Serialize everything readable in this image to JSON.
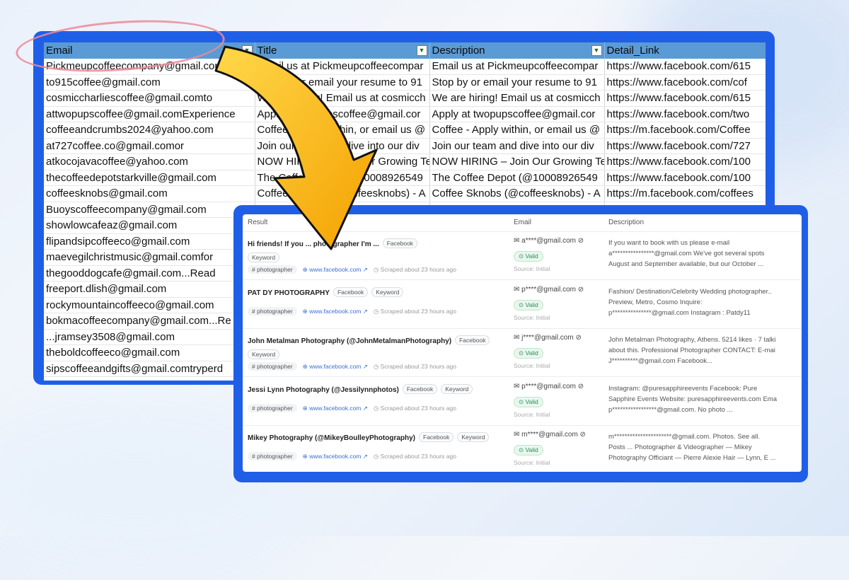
{
  "sheet": {
    "headers": [
      "Email",
      "Title",
      "Description",
      "Detail_Link"
    ],
    "rows": [
      [
        "Pickmeupcoffeecompany@gmail.comfor",
        "Email us at Pickmeupcoffeecompar",
        "Email us at Pickmeupcoffeecompar",
        "https://www.facebook.com/615"
      ],
      [
        "to915coffee@gmail.com",
        "Stop by or email your resume to 91",
        "Stop by or email your resume to 91",
        "https://www.facebook.com/cof"
      ],
      [
        "cosmiccharliescoffee@gmail.comto",
        "We are hiring! Email us at cosmicch",
        "We are hiring! Email us at cosmicch",
        "https://www.facebook.com/615"
      ],
      [
        "attwopupscoffee@gmail.comExperience",
        "Apply at twopupscoffee@gmail.cor",
        "Apply at twopupscoffee@gmail.cor",
        "https://www.facebook.com/two"
      ],
      [
        "coffeeandcrumbs2024@yahoo.com",
        "Coffee - Apply within, or email us @",
        "Coffee - Apply within, or email us @",
        "https://m.facebook.com/Coffee"
      ],
      [
        "at727coffee.co@gmail.comor",
        "Join our team and dive into our div",
        "Join our team and dive into our div",
        "https://www.facebook.com/727"
      ],
      [
        "atkocojavacoffee@yahoo.com",
        "NOW HIRING – Join Our Growing Te",
        "NOW HIRING – Join Our Growing Te",
        "https://www.facebook.com/100"
      ],
      [
        "thecoffeedepotstarkville@gmail.com",
        "The Coffee Depot (@10008926549",
        "The Coffee Depot (@10008926549",
        "https://www.facebook.com/100"
      ],
      [
        "coffeesknobs@gmail.com",
        "Coffee Sknobs (@coffeesknobs) - A",
        "Coffee Sknobs (@coffeesknobs) - A",
        "https://m.facebook.com/coffees"
      ],
      [
        "Buoyscoffeecompany@gmail.com",
        "",
        "",
        ""
      ],
      [
        "showlowcafeaz@gmail.com",
        "",
        "",
        ""
      ],
      [
        "flipandsipcoffeeco@gmail.com",
        "",
        "",
        ""
      ],
      [
        "maevegilchristmusic@gmail.comfor",
        "",
        "",
        ""
      ],
      [
        "thegooddogcafe@gmail.com...Read",
        "",
        "",
        ""
      ],
      [
        "freeport.dlish@gmail.com",
        "",
        "",
        ""
      ],
      [
        "rockymountaincoffeeco@gmail.com",
        "",
        "",
        ""
      ],
      [
        "bokmacoffeecompany@gmail.com...Re",
        "",
        "",
        ""
      ],
      [
        "...jramsey3508@gmail.com",
        "",
        "",
        ""
      ],
      [
        "theboldcoffeeco@gmail.com",
        "",
        "",
        ""
      ],
      [
        "sipscoffeeandgifts@gmail.comtryperd",
        "",
        "",
        ""
      ]
    ]
  },
  "panel": {
    "col_result": "Result",
    "col_email": "Email",
    "col_description": "Description",
    "rows": [
      {
        "title": "Hi friends! If you ... photographer I'm ...",
        "tags": [
          "Facebook",
          "Keyword"
        ],
        "keyword": "# photographer",
        "link": "www.facebook.com",
        "scraped": "Scraped about 23 hours ago",
        "email": "a****@gmail.com",
        "valid": "Valid",
        "source": "Source: Initial",
        "desc": [
          "If you want to book with us please e-mail",
          "a****************@gmail.com We've got several spots",
          "August and September available, but our October ..."
        ]
      },
      {
        "title": "PAT DY PHOTOGRAPHY",
        "tags": [
          "Facebook",
          "Keyword"
        ],
        "keyword": "# photographer",
        "link": "www.facebook.com",
        "scraped": "Scraped about 23 hours ago",
        "email": "p****@gmail.com",
        "valid": "Valid",
        "source": "Source: Initial",
        "desc": [
          "Fashion/ Destination/Celebrity Wedding photographer..",
          "Preview, Metro, Cosmo Inquire:",
          "p***************@gmail.com Instagram : Patdy11"
        ]
      },
      {
        "title": "John Metalman Photography (@JohnMetalmanPhotography)",
        "tags": [
          "Facebook",
          "Keyword"
        ],
        "keyword": "# photographer",
        "link": "www.facebook.com",
        "scraped": "Scraped about 23 hours ago",
        "email": "j****@gmail.com",
        "valid": "Valid",
        "source": "Source: Initial",
        "desc": [
          "John Metalman Photography, Athens. 5214 likes · 7 talki",
          "about this. Professional Photographer CONTACT: E-mai",
          "J**********@gmail.com Facebook..."
        ]
      },
      {
        "title": "Jessi Lynn Photography (@Jessilynnphotos)",
        "tags": [
          "Facebook",
          "Keyword"
        ],
        "keyword": "# photographer",
        "link": "www.facebook.com",
        "scraped": "Scraped about 23 hours ago",
        "email": "p****@gmail.com",
        "valid": "Valid",
        "source": "Source: Initial",
        "desc": [
          "Instagram: @puresapphireevents Facebook: Pure",
          "Sapphire Events Website: puresapphireevents.com Ema",
          "p*****************@gmail.com. No photo ..."
        ]
      },
      {
        "title": "Mikey Photography (@MikeyBoulleyPhotography)",
        "tags": [
          "Facebook",
          "Keyword"
        ],
        "keyword": "# photographer",
        "link": "www.facebook.com",
        "scraped": "Scraped about 23 hours ago",
        "email": "m****@gmail.com",
        "valid": "Valid",
        "source": "Source: Initial",
        "desc": [
          "m**********************@gmail.com. Photos. See all.",
          "Posts ... Photographer & Videographer — Mikey",
          "Photography Officiant — Pierre Alexie Hair — Lynn, E ..."
        ]
      }
    ]
  },
  "colors": {
    "frame": "#1f5fe8",
    "header": "#5b9bd5",
    "arrow": "#f7b500",
    "ring": "#ec8a96"
  },
  "icons": {
    "filter": "dropdown-filter-icon",
    "mail": "mail-icon",
    "hidden": "eye-off-icon",
    "globe": "globe-icon",
    "external": "external-link-icon",
    "clock": "clock-icon",
    "check": "check-circle-icon"
  }
}
